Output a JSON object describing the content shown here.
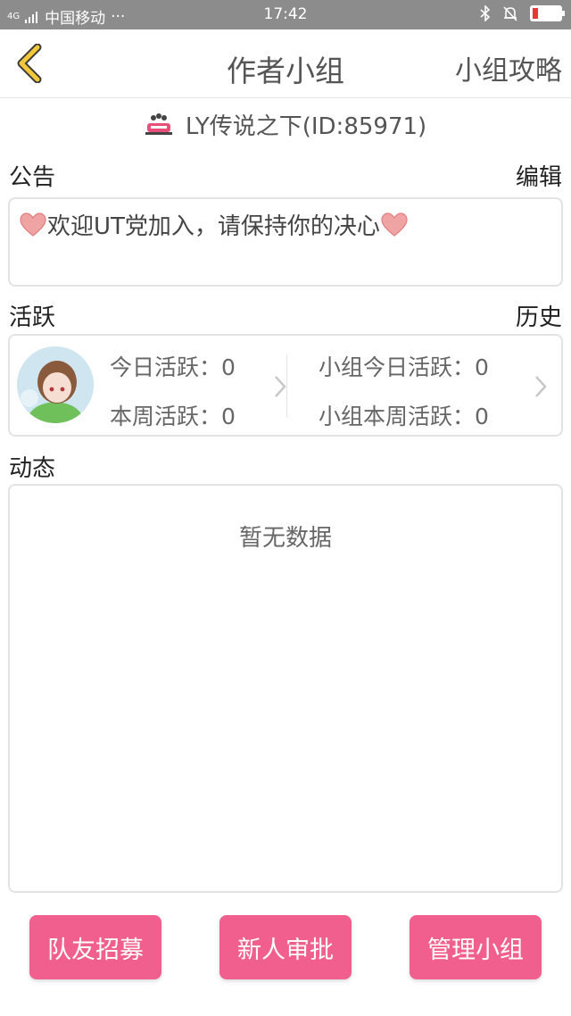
{
  "status_bar": {
    "network": "4G",
    "carrier": "中国移动",
    "dots": "···",
    "time": "17:42",
    "battery_level": 0.2
  },
  "header": {
    "title": "作者小组",
    "right_action": "小组攻略"
  },
  "group": {
    "name": "LY传说之下(ID:85971)"
  },
  "announcement": {
    "label": "公告",
    "action": "编辑",
    "text": "欢迎UT党加入，请保持你的决心"
  },
  "activity": {
    "label": "活跃",
    "action": "历史",
    "today_label": "今日活跃：",
    "today_value": "0",
    "week_label": "本周活跃：",
    "week_value": "0",
    "group_today_label": "小组今日活跃：",
    "group_today_value": "0",
    "group_week_label": "小组本周活跃：",
    "group_week_value": "0"
  },
  "feed": {
    "label": "动态",
    "empty_text": "暂无数据"
  },
  "buttons": {
    "recruit": "队友招募",
    "approve": "新人审批",
    "manage": "管理小组"
  },
  "colors": {
    "accent": "#f05f8e",
    "back_arrow": "#f2c73a",
    "status_bar": "#8c8c8c"
  }
}
